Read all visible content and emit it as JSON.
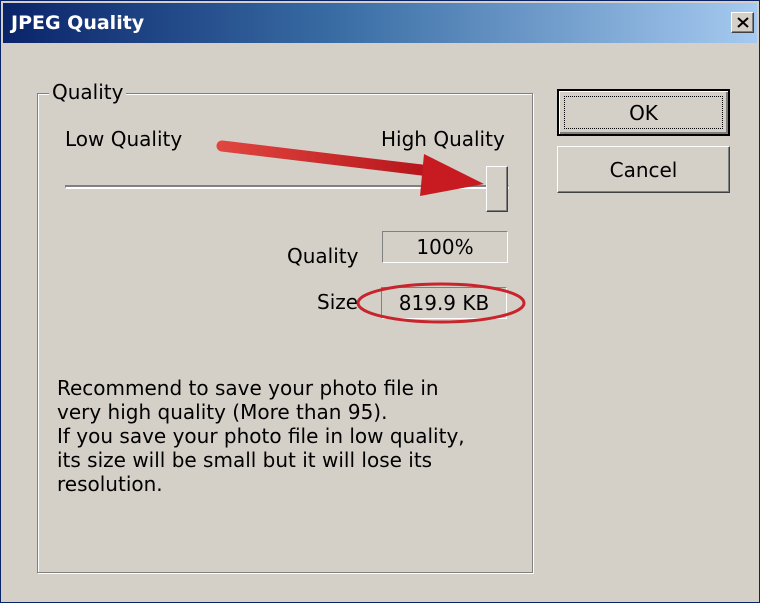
{
  "window": {
    "title": "JPEG Quality",
    "close_label": "×"
  },
  "group": {
    "label": "Quality"
  },
  "slider": {
    "low_label": "Low Quality",
    "high_label": "High Quality",
    "value_fraction": 1.0
  },
  "quality": {
    "label": "Quality",
    "value": "100%"
  },
  "size": {
    "label": "Size",
    "value": "819.9 KB"
  },
  "description": {
    "lines": [
      "Recommend to save your photo file in",
      "very high quality (More than 95).",
      "If you save your photo file in low quality,",
      "its size will be small but it will lose its",
      "resolution."
    ]
  },
  "buttons": {
    "ok_label": "OK",
    "cancel_label": "Cancel"
  },
  "annotations": {
    "arrow_color": "#d21f1f",
    "ellipse_color": "#c8242b"
  }
}
